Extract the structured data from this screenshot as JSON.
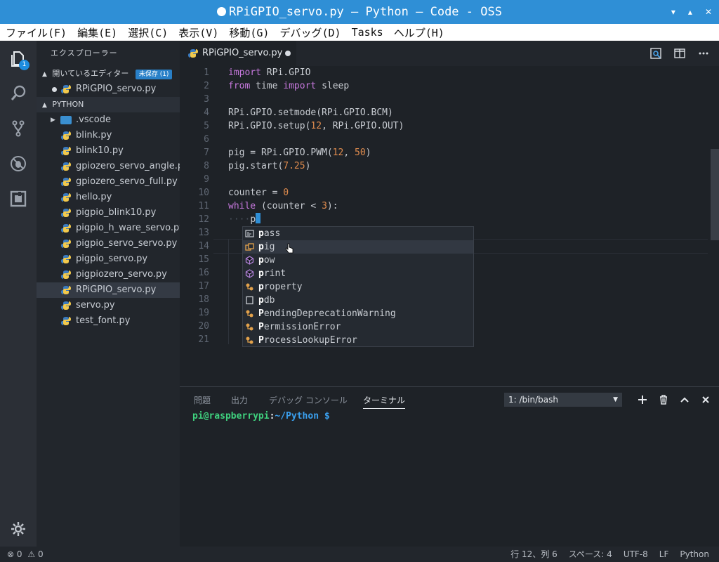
{
  "window": {
    "title": "RPiGPIO_servo.py — Python — Code - OSS",
    "buttons": [
      "▾",
      "▴",
      "✕"
    ]
  },
  "menu": [
    "ファイル(F)",
    "編集(E)",
    "選択(C)",
    "表示(V)",
    "移動(G)",
    "デバッグ(D)",
    "Tasks",
    "ヘルプ(H)"
  ],
  "activity": {
    "explorer_badge": "1"
  },
  "sidebar": {
    "title": "エクスプローラー",
    "open_editors_label": "開いているエディター",
    "unsaved_label": "未保存 (1)",
    "open_file": "RPiGPIO_servo.py",
    "folder_label": "PYTHON",
    "vscode_folder": ".vscode",
    "files": [
      "blink.py",
      "blink10.py",
      "gpiozero_servo_angle.py",
      "gpiozero_servo_full.py",
      "hello.py",
      "pigpio_blink10.py",
      "pigpio_h_ware_servo.py",
      "pigpio_servo_servo.py",
      "pigpio_servo.py",
      "pigpiozero_servo.py",
      "RPiGPIO_servo.py",
      "servo.py",
      "test_font.py"
    ],
    "active_file": "RPiGPIO_servo.py"
  },
  "editor": {
    "tab_label": "RPiGPIO_servo.py",
    "line_numbers": [
      "1",
      "2",
      "3",
      "4",
      "5",
      "6",
      "7",
      "8",
      "9",
      "10",
      "11",
      "12",
      "13",
      "14",
      "15",
      "16",
      "17",
      "18",
      "19",
      "20",
      "21"
    ],
    "code": {
      "l1_kw": "import",
      "l1_rest": " RPi.GPIO",
      "l2_kw1": "from",
      "l2_mid": " time ",
      "l2_kw2": "import",
      "l2_rest": " sleep",
      "l4": "RPi.GPIO.setmode(RPi.GPIO.BCM)",
      "l5_a": "RPi.GPIO.setup(",
      "l5_num": "12",
      "l5_b": ", RPi.GPIO.OUT)",
      "l7_a": "pig = RPi.GPIO.PWM(",
      "l7_n1": "12",
      "l7_b": ", ",
      "l7_n2": "50",
      "l7_c": ")",
      "l8_a": "pig.start(",
      "l8_num": "7.25",
      "l8_b": ")",
      "l10_a": "counter = ",
      "l10_num": "0",
      "l11_kw": "while",
      "l11_a": " (counter < ",
      "l11_num": "3",
      "l11_b": "):",
      "l12_ws": "····",
      "l12_typed": "p"
    },
    "suggestions": [
      {
        "bold": "p",
        "rest": "ass",
        "icon": "keyword-icon"
      },
      {
        "bold": "p",
        "rest": "ig",
        "icon": "variable-icon"
      },
      {
        "bold": "p",
        "rest": "ow",
        "icon": "function-icon"
      },
      {
        "bold": "p",
        "rest": "rint",
        "icon": "function-icon"
      },
      {
        "bold": "p",
        "rest": "roperty",
        "icon": "class-icon"
      },
      {
        "bold": "p",
        "rest": "db",
        "icon": "module-icon"
      },
      {
        "bold": "P",
        "rest": "endingDeprecationWarning",
        "icon": "class-icon"
      },
      {
        "bold": "P",
        "rest": "ermissionError",
        "icon": "class-icon"
      },
      {
        "bold": "P",
        "rest": "rocessLookupError",
        "icon": "class-icon"
      }
    ]
  },
  "panel": {
    "tabs": [
      "問題",
      "出力",
      "デバッグ コンソール",
      "ターミナル"
    ],
    "active_tab": "ターミナル",
    "terminal_select": "1: /bin/bash",
    "prompt_user": "pi@raspberrypi",
    "prompt_sep": ":",
    "prompt_path": "~/Python $"
  },
  "status": {
    "errors": "0",
    "warnings": "0",
    "position": "行 12、列 6",
    "spaces": "スペース: 4",
    "encoding": "UTF-8",
    "eol": "LF",
    "language": "Python"
  },
  "colors": {
    "accent": "#2f8fd6",
    "prompt_user": "#3fd17e",
    "prompt_path": "#3aa0ef"
  }
}
